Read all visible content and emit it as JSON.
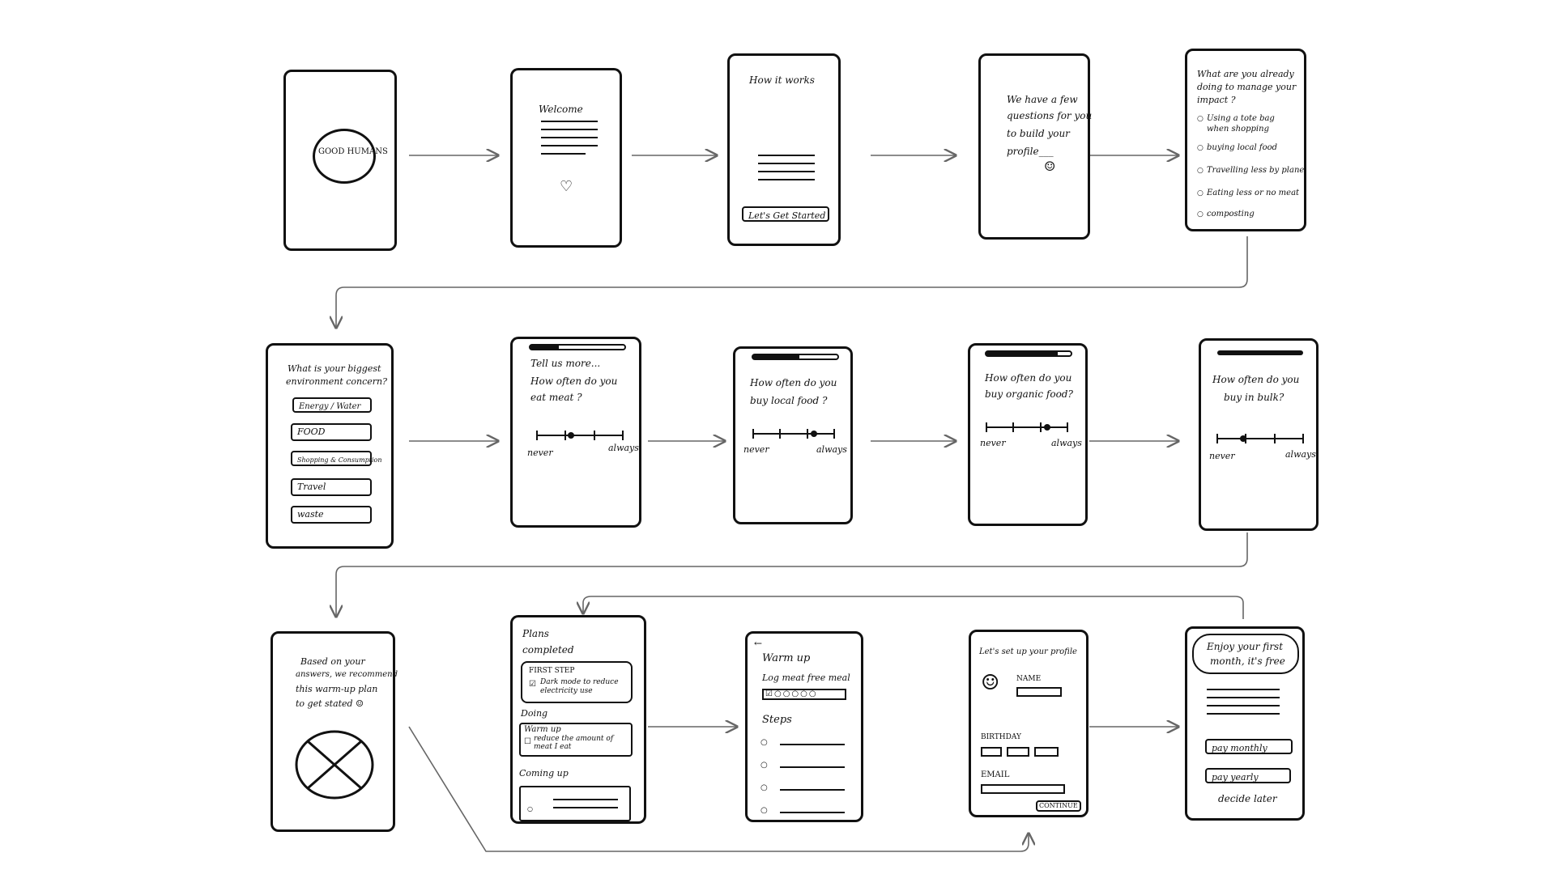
{
  "splash": {
    "logo": "GOOD HUMANS"
  },
  "welcome": {
    "title": "Welcome",
    "icon": "heart-icon"
  },
  "how": {
    "title": "How it works",
    "cta": "Let's Get Started"
  },
  "questions_intro": {
    "text": [
      "We have a few",
      "questions for you",
      "to build your",
      "profile___"
    ],
    "icon": "smiley-icon"
  },
  "already_doing": {
    "title": [
      "What are you already",
      "doing to manage your",
      "impact ?"
    ],
    "options": [
      "Using a tote bag\nwhen shopping",
      "buying local food",
      "Travelling less by plane",
      "Eating less or no meat",
      "composting"
    ]
  },
  "concern": {
    "title": [
      "What is your biggest",
      "environment concern?"
    ],
    "options": [
      "Energy / Water",
      "FOOD",
      "Shopping & Consumption",
      "Travel",
      "waste"
    ]
  },
  "q_meat": {
    "title": [
      "Tell us more...",
      "How often do you",
      "eat meat ?"
    ],
    "min": "never",
    "max": "always",
    "progress": 0.3,
    "value": 0.4
  },
  "q_local": {
    "title": [
      "How often do you",
      "buy local food ?"
    ],
    "min": "never",
    "max": "always",
    "progress": 0.55,
    "value": 0.75
  },
  "q_organic": {
    "title": [
      "How often do you",
      "buy organic food?"
    ],
    "min": "never",
    "max": "always",
    "progress": 0.85,
    "value": 0.75
  },
  "q_bulk": {
    "title": [
      "How often do you",
      "buy in bulk?"
    ],
    "min": "never",
    "max": "always",
    "progress": 1.0,
    "value": 0.3
  },
  "recommend": {
    "text": [
      "Based on your",
      "answers, we recommend",
      "this warm-up plan",
      "to get stated ☺"
    ]
  },
  "plans": {
    "title": [
      "Plans",
      "completed"
    ],
    "completed": {
      "label": "FIRST STEP",
      "item": "Dark mode to reduce\nelectricity use"
    },
    "doing": {
      "label": "Doing",
      "title": "Warm up",
      "item": "reduce the amount of\nmeat I eat"
    },
    "coming": {
      "label": "Coming up"
    }
  },
  "warmup": {
    "back": "←",
    "title": "Warm up",
    "task": "Log meat free meal",
    "steps_label": "Steps"
  },
  "profile": {
    "title": "Let's set up your profile",
    "name": "NAME",
    "birthday": "BIRTHDAY",
    "email": "EMAIL",
    "continue": "CONTINUE"
  },
  "pricing": {
    "title": [
      "Enjoy your first",
      "month, it's free"
    ],
    "monthly": "pay monthly",
    "yearly": "pay yearly",
    "later": "decide later"
  }
}
